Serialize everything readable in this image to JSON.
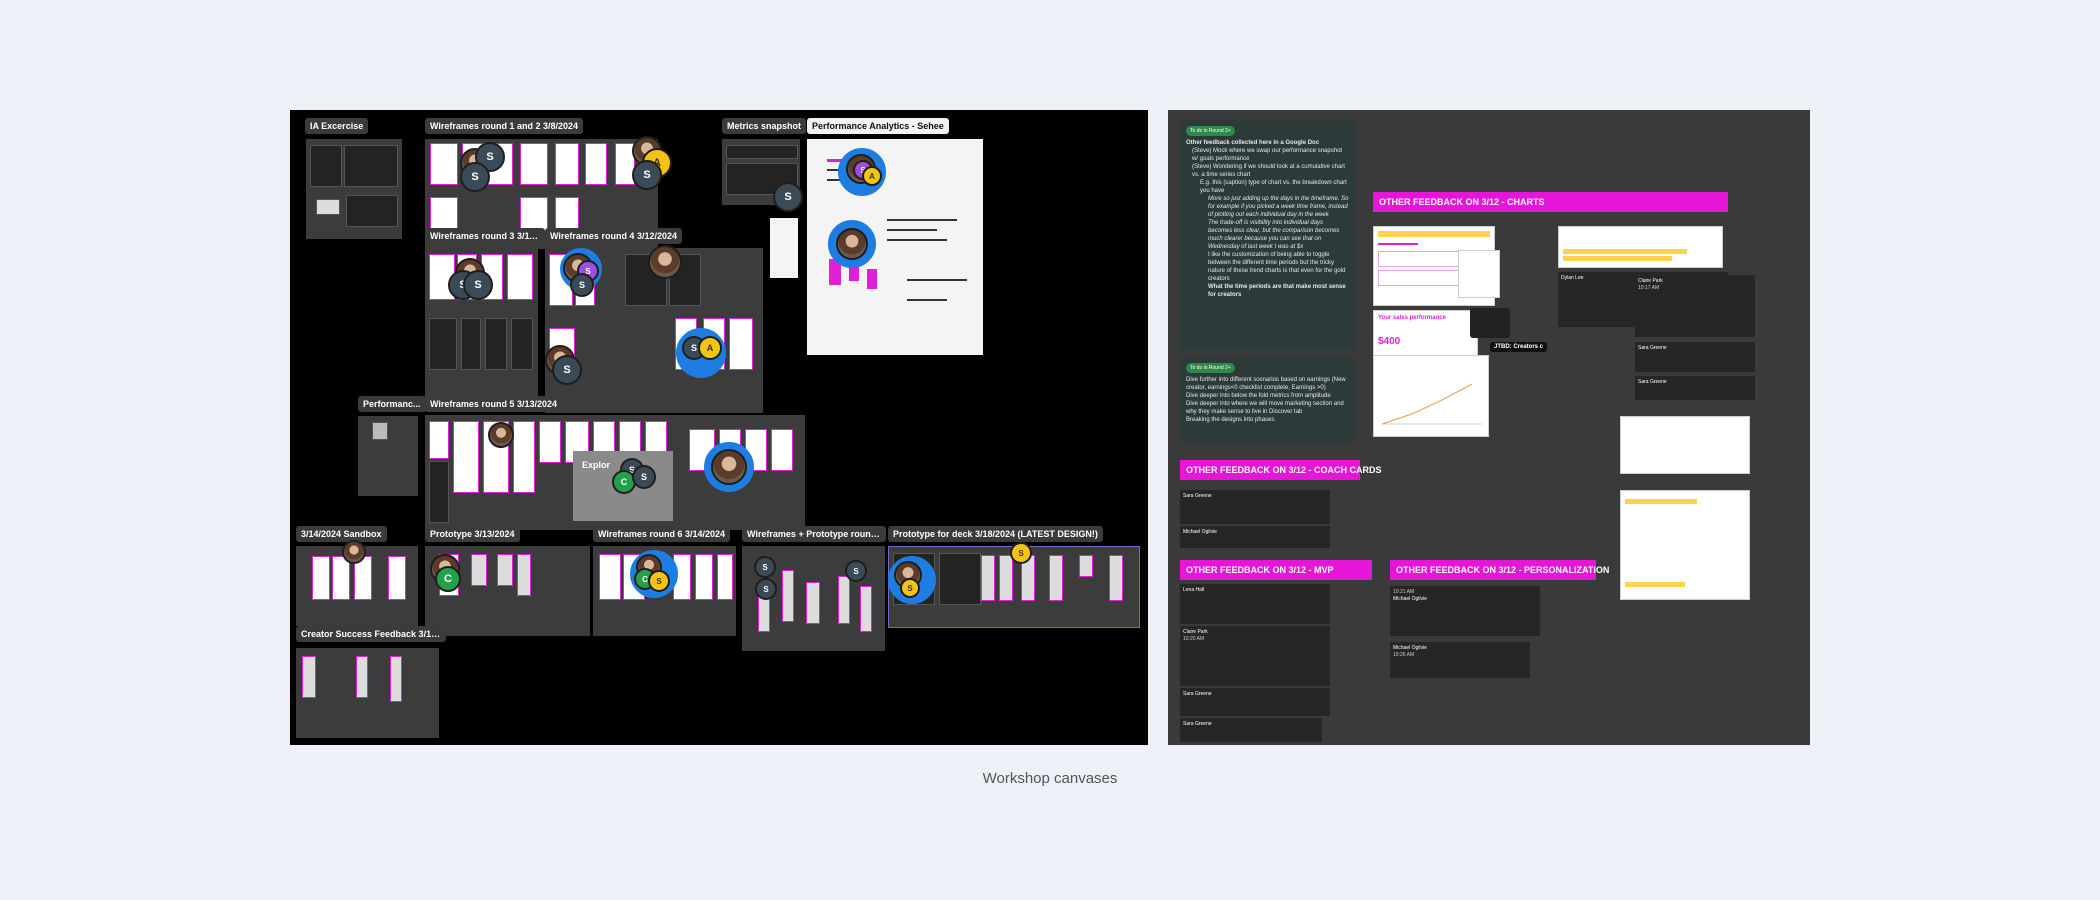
{
  "caption": "Workshop canvases",
  "left_canvas": {
    "frames": {
      "ia": "IA Excercise",
      "wf12": "Wireframes round 1 and 2 3/8/2024",
      "metrics": "Metrics snapshot",
      "perf_sehee": "Performance Analytics - Sehee",
      "wf3": "Wireframes round 3 3/11/...",
      "wf4": "Wireframes round 4 3/12/2024",
      "perf_small": "Performanc...",
      "wf5": "Wireframes round 5 3/13/2024",
      "explore": "Explor",
      "sandbox": "3/14/2024 Sandbox",
      "proto": "Prototype 3/13/2024",
      "wf6": "Wireframes round 6 3/14/2024",
      "wf_proto7": "Wireframes + Prototype round 7 ...",
      "deck": "Prototype for deck 3/18/2024 (LATEST DESIGN!)",
      "creator": "Creator Success Feedback 3/15/..."
    },
    "avatars": {
      "s": "S",
      "a": "A",
      "c": "C"
    }
  },
  "right_canvas": {
    "pill": "To do in Round 2+",
    "feedback_intro": "Other feedback collected here in a Google Doc",
    "feedback_lines": [
      "(Steve) Mock where we swap our performance snapshot w/ goals performance",
      "(Steve) Wondering if we should look at a cumulative chart vs. a time series chart",
      "E.g. this (caption) type of chart vs. the breakdown chart you have",
      "More so just adding up the days in the timeframe. So for example if you picked a week time frame, instead of plotting out each individual day in the week",
      "The trade-off is visibility into individual days becomes less clear, but the comparison becomes much clearer because you can see that on Wednesday of last week I was at $x",
      "I like the customization of being able to toggle between the different time periods but the tricky nature of these trend charts is that even for the gold creators",
      "What the time periods are that make most sense for creators"
    ],
    "second_pill": "To do in Round 2+",
    "second_lines": [
      "Dive further into different scenarios based on earnings (New creator, earnings<0 checklist complete, Earnings >0)",
      "Dive deeper into below the fold metrics from amplitude",
      "Dive deeper into where we will move marketing section and why they make sense to live in Discover tab",
      "Breaking the designs into phases"
    ],
    "sections": {
      "charts": "OTHER FEEDBACK ON 3/12 - CHARTS",
      "coach": "OTHER FEEDBACK ON 3/12 - COACH CARDS",
      "mvp": "OTHER FEEDBACK ON 3/12 - MVP",
      "personalization": "OTHER FEEDBACK ON 3/12 - PERSONALIZATION"
    },
    "sales_title": "Your sales performance",
    "sales_value": "$400",
    "tag_creators": "JTBD: Creators c",
    "chat_names": [
      "Sara Greene",
      "Dylan Lee",
      "Claire Park",
      "Michael Ogilvie",
      "Sara Greene",
      "Lena Hall"
    ],
    "chat_times": [
      "10:17 AM",
      "10:20 AM",
      "10:21 AM",
      "10:26 AM"
    ]
  }
}
